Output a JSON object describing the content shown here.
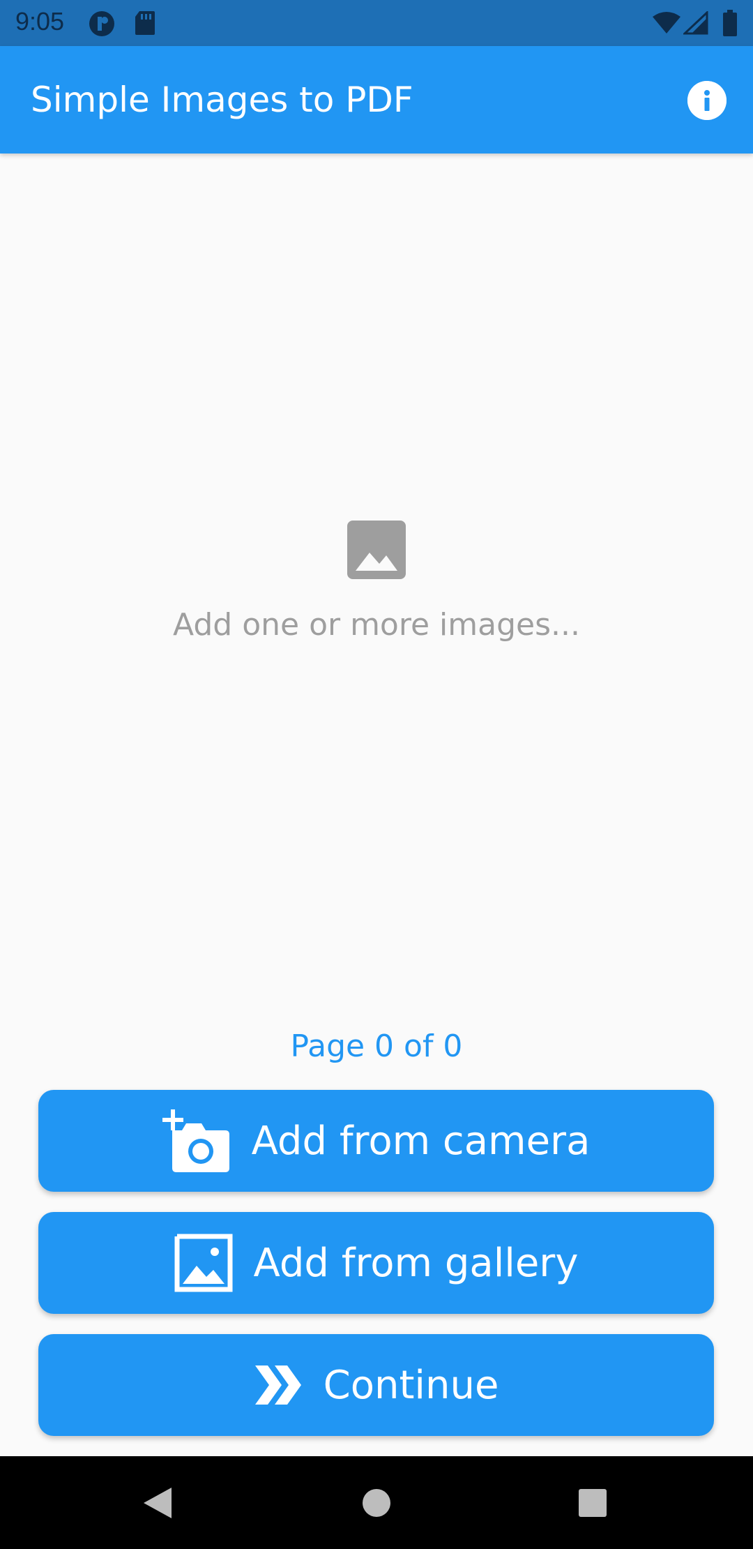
{
  "status_bar": {
    "time": "9:05",
    "icons": [
      "notification-icon",
      "sd-card-icon",
      "wifi-icon",
      "signal-icon",
      "battery-icon"
    ]
  },
  "app_bar": {
    "title": "Simple Images to PDF",
    "info_icon": "info-icon"
  },
  "empty_state": {
    "icon": "image-icon",
    "message": "Add one or more images..."
  },
  "page_indicator": "Page 0 of 0",
  "buttons": {
    "camera": {
      "label": "Add from camera",
      "icon": "add-camera-icon"
    },
    "gallery": {
      "label": "Add from gallery",
      "icon": "gallery-icon"
    },
    "continue": {
      "label": "Continue",
      "icon": "double-chevron-right-icon"
    }
  },
  "nav_bar": {
    "back_icon": "back-icon",
    "home_icon": "home-icon",
    "recents_icon": "recents-icon"
  },
  "colors": {
    "primary": "#2196f3",
    "status_bar": "#1e6fb5",
    "background": "#fafafa",
    "muted_text": "#9e9e9e"
  }
}
